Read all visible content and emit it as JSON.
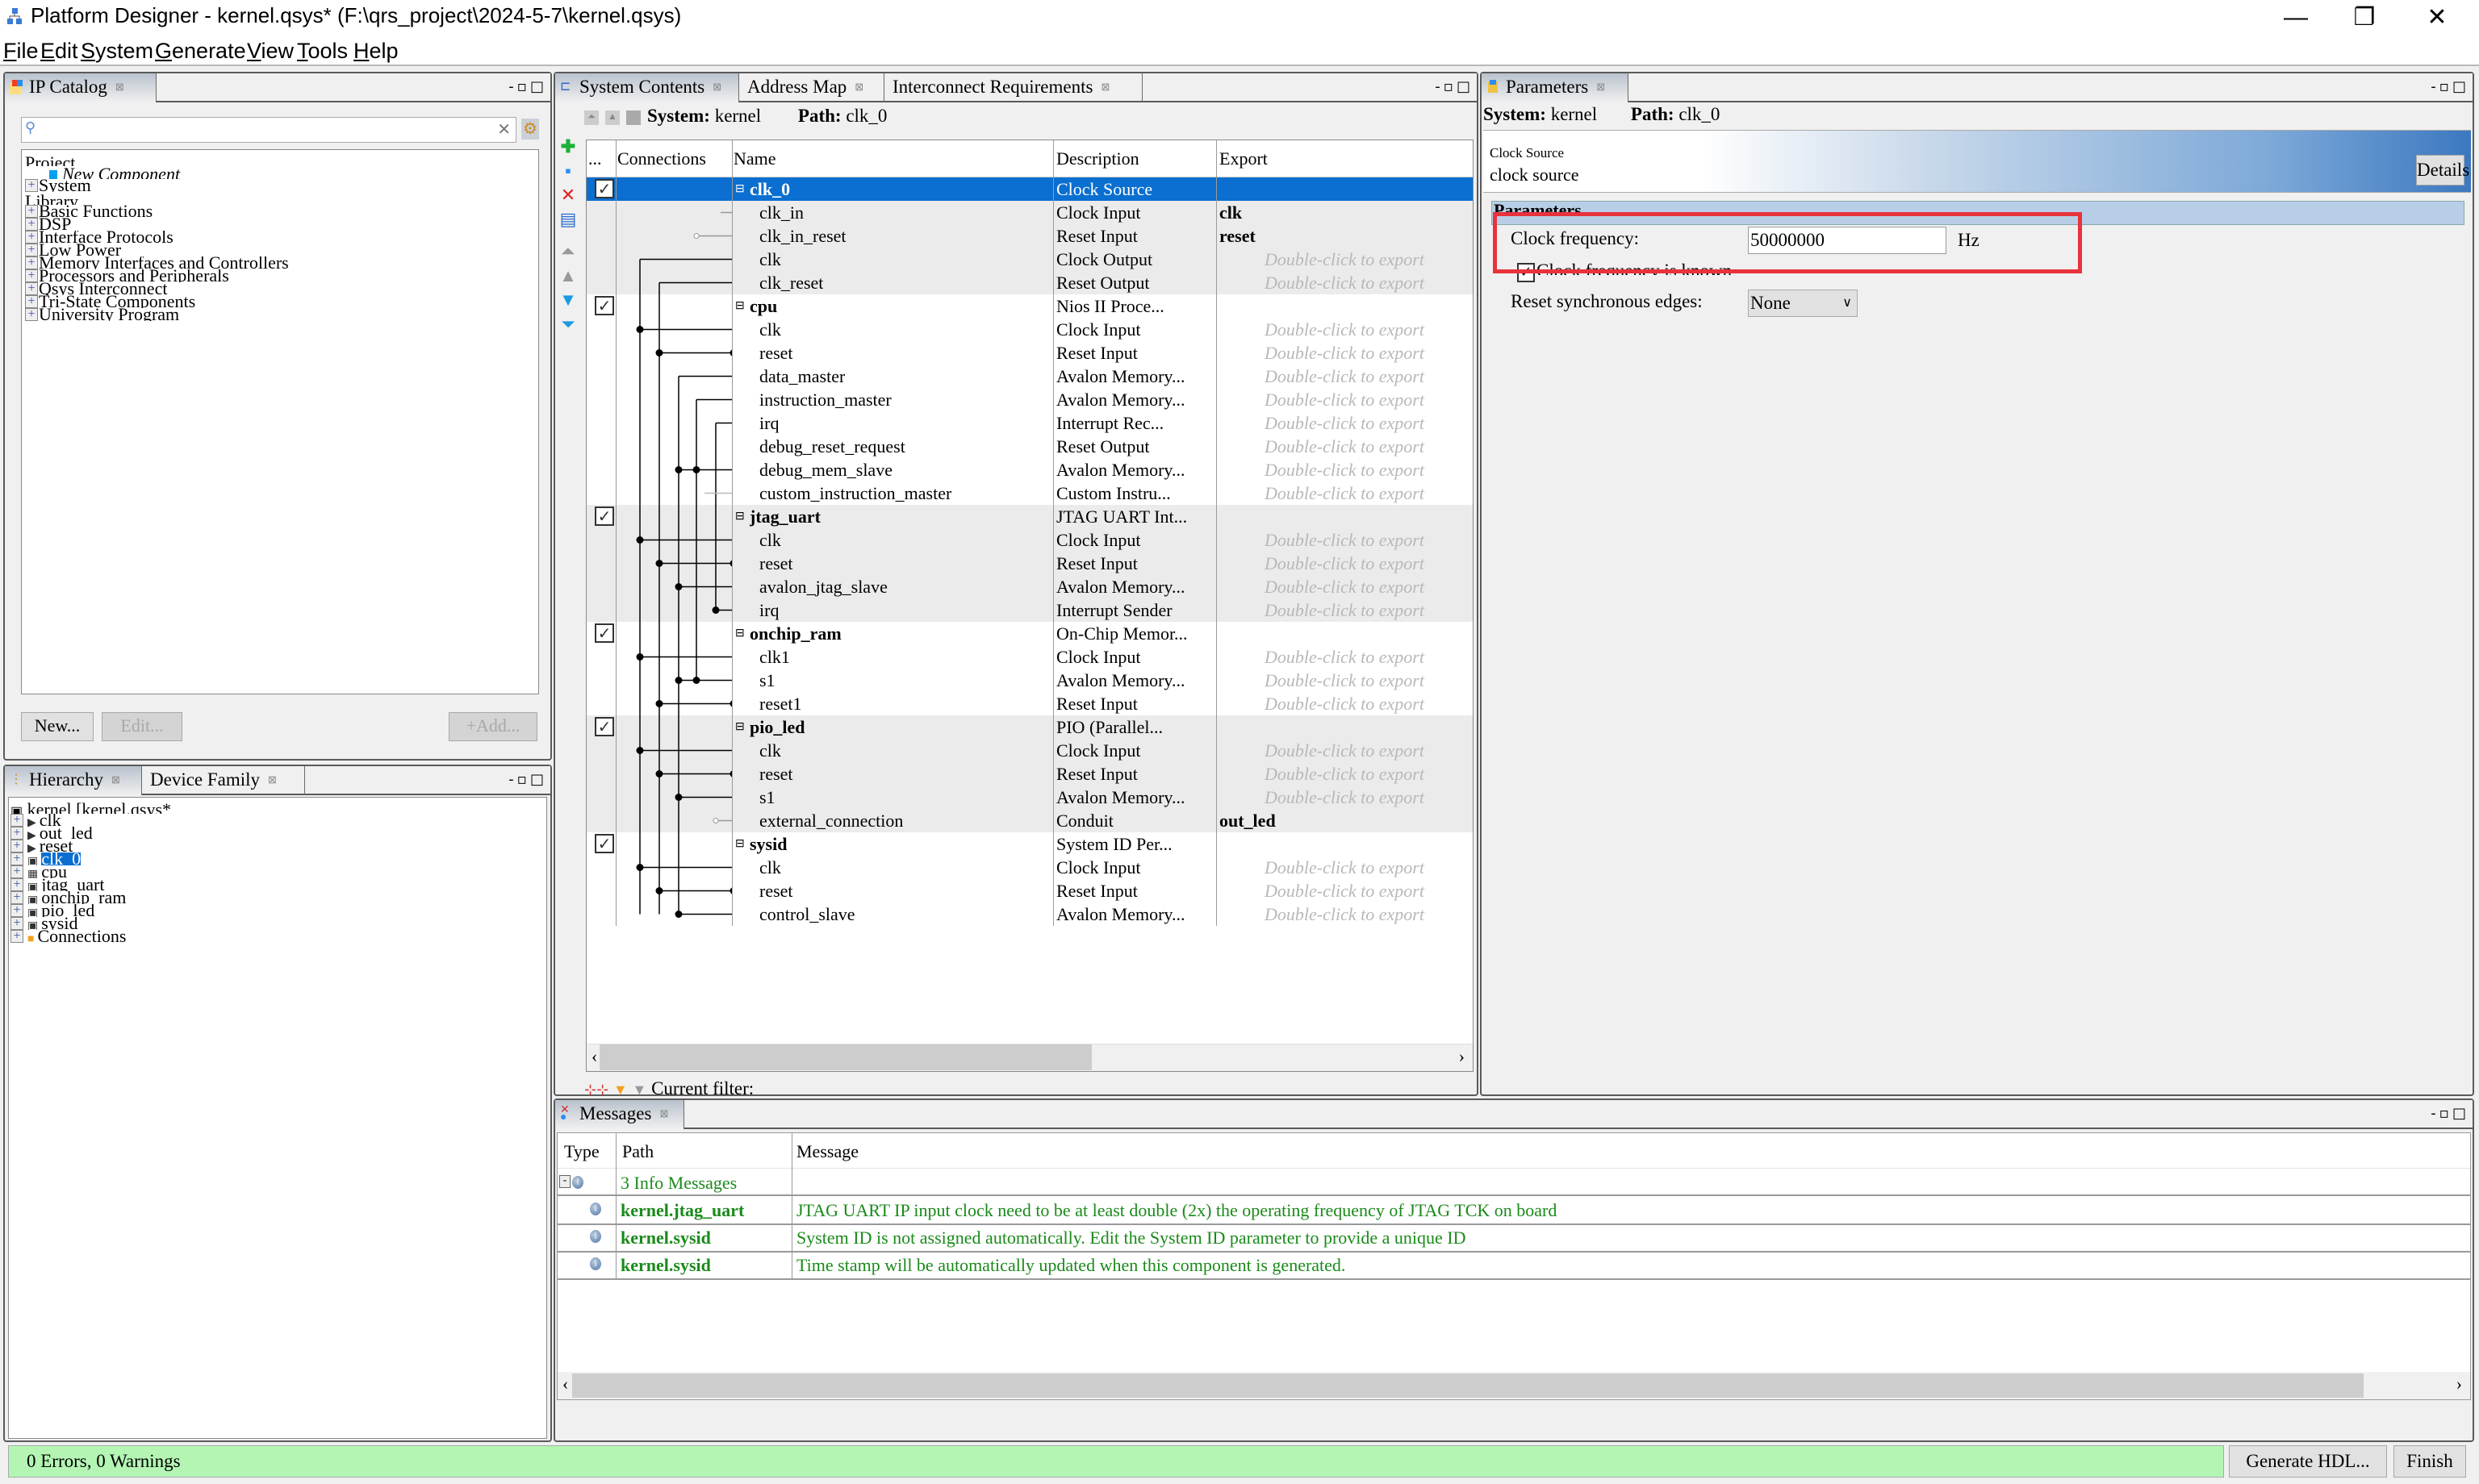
{
  "window": {
    "title": "Platform Designer - kernel.qsys* (F:\\qrs_project\\2024-5-7\\kernel.qsys)",
    "minimize": "—",
    "restore": "❐",
    "close": "✕"
  },
  "menu": [
    "File",
    "Edit",
    "System",
    "Generate",
    "View",
    "Tools",
    "Help"
  ],
  "ip_catalog": {
    "tab": "IP Catalog",
    "search_placeholder": "",
    "tree": {
      "project_header": "Project",
      "new_component": "New Component",
      "system": "System",
      "library_header": "Library",
      "library": [
        "Basic Functions",
        "DSP",
        "Interface Protocols",
        "Low Power",
        "Memory Interfaces and Controllers",
        "Processors and Peripherals",
        "Qsys Interconnect",
        "Tri-State Components",
        "University Program"
      ]
    },
    "buttons": {
      "new": "New...",
      "edit": "Edit...",
      "add": "Add..."
    }
  },
  "hierarchy": {
    "tabs": [
      "Hierarchy",
      "Device Family"
    ],
    "root": "kernel [kernel.qsys*",
    "items": [
      {
        "label": "clk",
        "icon": "export"
      },
      {
        "label": "out_led",
        "icon": "export"
      },
      {
        "label": "reset",
        "icon": "export"
      },
      {
        "label": "clk_0",
        "icon": "component",
        "selected": true
      },
      {
        "label": "cpu",
        "icon": "cpu"
      },
      {
        "label": "jtag_uart",
        "icon": "component"
      },
      {
        "label": "onchip_ram",
        "icon": "component"
      },
      {
        "label": "pio_led",
        "icon": "component"
      },
      {
        "label": "sysid",
        "icon": "component"
      },
      {
        "label": "Connections",
        "icon": "folder"
      }
    ]
  },
  "system_contents": {
    "tabs": [
      "System Contents",
      "Address Map",
      "Interconnect Requirements"
    ],
    "system_label": "System:",
    "system_value": "kernel",
    "path_label": "Path:",
    "path_value": "clk_0",
    "columns": [
      "...",
      "Connections",
      "Name",
      "Description",
      "Export"
    ],
    "export_hint": "Double-click to export",
    "rows": [
      {
        "type": "component",
        "name": "clk_0",
        "desc": "Clock Source",
        "export": "",
        "checked": true,
        "selected": true
      },
      {
        "type": "port",
        "name": "clk_in",
        "desc": "Clock Input",
        "export": "clk"
      },
      {
        "type": "port",
        "name": "clk_in_reset",
        "desc": "Reset Input",
        "export": "reset"
      },
      {
        "type": "port",
        "name": "clk",
        "desc": "Clock Output",
        "export": null
      },
      {
        "type": "port",
        "name": "clk_reset",
        "desc": "Reset Output",
        "export": null
      },
      {
        "type": "component",
        "name": "cpu",
        "desc": "Nios II Proce...",
        "export": "",
        "checked": true
      },
      {
        "type": "port",
        "name": "clk",
        "desc": "Clock Input",
        "export": null
      },
      {
        "type": "port",
        "name": "reset",
        "desc": "Reset Input",
        "export": null
      },
      {
        "type": "port",
        "name": "data_master",
        "desc": "Avalon Memory...",
        "export": null
      },
      {
        "type": "port",
        "name": "instruction_master",
        "desc": "Avalon Memory...",
        "export": null
      },
      {
        "type": "port",
        "name": "irq",
        "desc": "Interrupt Rec...",
        "export": null
      },
      {
        "type": "port",
        "name": "debug_reset_request",
        "desc": "Reset Output",
        "export": null
      },
      {
        "type": "port",
        "name": "debug_mem_slave",
        "desc": "Avalon Memory...",
        "export": null
      },
      {
        "type": "port",
        "name": "custom_instruction_master",
        "desc": "Custom Instru...",
        "export": null
      },
      {
        "type": "component",
        "name": "jtag_uart",
        "desc": "JTAG UART Int...",
        "export": "",
        "checked": true
      },
      {
        "type": "port",
        "name": "clk",
        "desc": "Clock Input",
        "export": null
      },
      {
        "type": "port",
        "name": "reset",
        "desc": "Reset Input",
        "export": null
      },
      {
        "type": "port",
        "name": "avalon_jtag_slave",
        "desc": "Avalon Memory...",
        "export": null
      },
      {
        "type": "port",
        "name": "irq",
        "desc": "Interrupt Sender",
        "export": null
      },
      {
        "type": "component",
        "name": "onchip_ram",
        "desc": "On-Chip Memor...",
        "export": "",
        "checked": true
      },
      {
        "type": "port",
        "name": "clk1",
        "desc": "Clock Input",
        "export": null
      },
      {
        "type": "port",
        "name": "s1",
        "desc": "Avalon Memory...",
        "export": null
      },
      {
        "type": "port",
        "name": "reset1",
        "desc": "Reset Input",
        "export": null
      },
      {
        "type": "component",
        "name": "pio_led",
        "desc": "PIO (Parallel...",
        "export": "",
        "checked": true
      },
      {
        "type": "port",
        "name": "clk",
        "desc": "Clock Input",
        "export": null
      },
      {
        "type": "port",
        "name": "reset",
        "desc": "Reset Input",
        "export": null
      },
      {
        "type": "port",
        "name": "s1",
        "desc": "Avalon Memory...",
        "export": null
      },
      {
        "type": "port",
        "name": "external_connection",
        "desc": "Conduit",
        "export": "out_led"
      },
      {
        "type": "component",
        "name": "sysid",
        "desc": "System ID Per...",
        "export": "",
        "checked": true
      },
      {
        "type": "port",
        "name": "clk",
        "desc": "Clock Input",
        "export": null
      },
      {
        "type": "port",
        "name": "reset",
        "desc": "Reset Input",
        "export": null
      },
      {
        "type": "port",
        "name": "control_slave",
        "desc": "Avalon Memory...",
        "export": null
      }
    ],
    "filter_label": "Current filter:"
  },
  "parameters": {
    "tab": "Parameters",
    "system_label": "System:",
    "system_value": "kernel",
    "path_label": "Path:",
    "path_value": "clk_0",
    "component_type": "Clock Source",
    "component_desc": "clock source",
    "details_button": "Details",
    "group_label": "Parameters",
    "clock_frequency_label": "Clock frequency:",
    "clock_frequency_value": "50000000",
    "clock_frequency_unit": "Hz",
    "clock_known_label": "Clock frequency is known",
    "clock_known_checked": true,
    "reset_edges_label": "Reset synchronous edges:",
    "reset_edges_value": "None",
    "highlight_color": "#e8323c"
  },
  "messages": {
    "tab": "Messages",
    "columns": [
      "Type",
      "Path",
      "Message"
    ],
    "group_label": "3 Info Messages",
    "items": [
      {
        "path": "kernel.jtag_uart",
        "message": "JTAG UART IP input clock need to be at least double (2x) the operating frequency of JTAG TCK on board"
      },
      {
        "path": "kernel.sysid",
        "message": "System ID is not assigned automatically. Edit the System ID parameter to provide a unique ID"
      },
      {
        "path": "kernel.sysid",
        "message": "Time stamp will be automatically updated when this component is generated."
      }
    ]
  },
  "status": {
    "text": "0 Errors, 0 Warnings",
    "color": "#b4f5b4",
    "generate_button": "Generate HDL...",
    "finish_button": "Finish"
  }
}
